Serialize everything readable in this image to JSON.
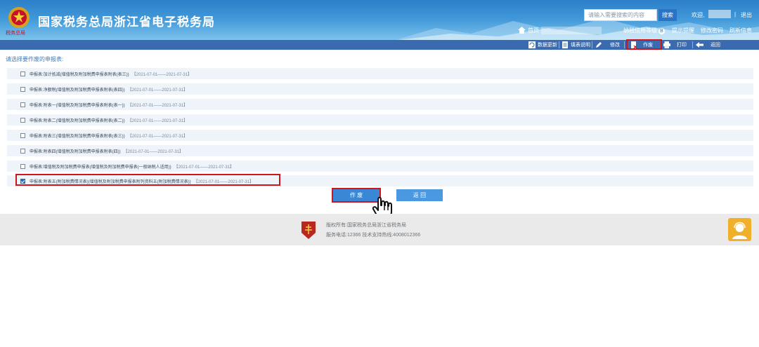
{
  "header": {
    "emblem_text": "税务总局",
    "title": "国家税务总局浙江省电子税务局",
    "search_placeholder": "请输入需要搜索的内容",
    "search_button": "搜索",
    "welcome": "欢迎,",
    "divider": "|",
    "logout": "退出",
    "home": "首页",
    "credit_label": "纳税信用等级",
    "credit_badge": "B",
    "links": [
      "提示提醒",
      "修改密码",
      "刷新信息"
    ]
  },
  "toolbar": {
    "items": [
      {
        "label": "数据更新",
        "icon": "refresh-icon"
      },
      {
        "label": "填表说明",
        "icon": "document-icon"
      },
      {
        "label": "修改",
        "icon": "pencil-icon"
      },
      {
        "label": "作废",
        "icon": "void-document-icon"
      },
      {
        "label": "打印",
        "icon": "printer-icon"
      },
      {
        "label": "返回",
        "icon": "back-arrow-icon"
      }
    ]
  },
  "form": {
    "prompt": "请选择要作废的申报表:",
    "rows": [
      {
        "name": "申报表:加计抵减(增值税及附加税费申报表附表(表三))",
        "period": "【2021-07-01——2021-07-31】",
        "checked": false
      },
      {
        "name": "申报表:净额税(增值税及附加税费申报表附表(表四))",
        "period": "【2021-07-01——2021-07-31】",
        "checked": false
      },
      {
        "name": "申报表:附表一(增值税及附加税费申报表附表(表一))",
        "period": "【2021-07-01——2021-07-31】",
        "checked": false
      },
      {
        "name": "申报表:附表二(增值税及附加税费申报表附表(表二))",
        "period": "【2021-07-01——2021-07-31】",
        "checked": false
      },
      {
        "name": "申报表:附表三(增值税及附加税费申报表附表(表三))",
        "period": "【2021-07-01——2021-07-31】",
        "checked": false
      },
      {
        "name": "申报表:附表四(增值税及附加税费申报表附表(四))",
        "period": "【2021-07-01——2021-07-31】",
        "checked": false
      },
      {
        "name": "申报表:增值税及附加税费申报表(增值税及附加税费申报表(一般纳税人适用))",
        "period": "【2021-07-01——2021-07-31】",
        "checked": false
      },
      {
        "name": "申报表:附表五(附加税费情况表)(增值税及附加税费申报表附列资料五(附加税费情况表))",
        "period": "【2021-07-01——2021-07-31】",
        "checked": true
      }
    ],
    "void_button": "作 废",
    "back_button": "返 回"
  },
  "footer": {
    "line1": "版权所有:国家税务总局浙江省税务局",
    "line2": "服务电话:12366 技术支持热线:4008012366"
  },
  "colors": {
    "header_blue": "#2c7fc8",
    "toolbar_blue": "#3a6bb0",
    "highlight_red": "#d0141c",
    "button_blue": "#3a87d6",
    "service_orange": "#f1b02b"
  }
}
